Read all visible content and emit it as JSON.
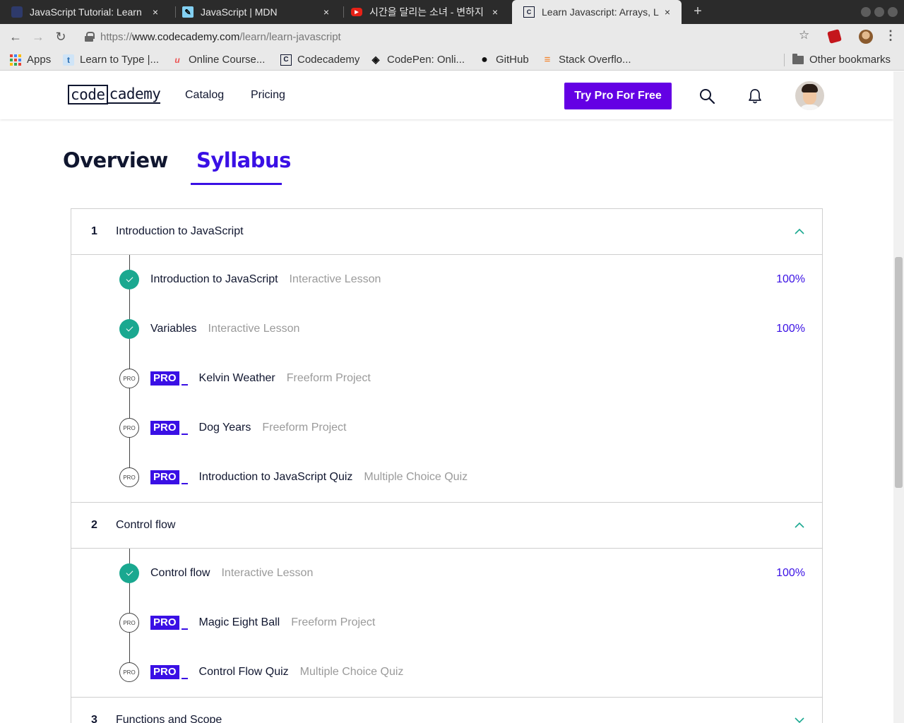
{
  "browser": {
    "tabs": [
      {
        "title": "JavaScript Tutorial: Learn",
        "favicon": "javascript-tutorial-favicon",
        "active": false
      },
      {
        "title": "JavaScript | MDN",
        "favicon": "mdn-favicon",
        "active": false
      },
      {
        "title": "시간을 달리는 소녀 - 변하지",
        "favicon": "youtube-favicon",
        "active": false
      },
      {
        "title": "Learn Javascript: Arrays, L",
        "favicon": "codecademy-favicon",
        "active": true
      }
    ],
    "close_glyph": "×",
    "new_tab_glyph": "+",
    "url": {
      "scheme": "https://",
      "host": "www.codecademy.com",
      "path": "/learn/learn-javascript"
    },
    "bookmarks": [
      {
        "label": "Apps",
        "icon": "apps-grid-icon"
      },
      {
        "label": "Learn to Type |...",
        "icon": "typing-club-icon",
        "glyph": "t"
      },
      {
        "label": "Online Course...",
        "icon": "udemy-icon",
        "glyph": "u"
      },
      {
        "label": "Codecademy",
        "icon": "codecademy-icon",
        "glyph": "C"
      },
      {
        "label": "CodePen: Onli...",
        "icon": "codepen-icon",
        "glyph": "◈"
      },
      {
        "label": "GitHub",
        "icon": "github-icon",
        "glyph": "●"
      },
      {
        "label": "Stack Overflo...",
        "icon": "stackoverflow-icon",
        "glyph": "≡"
      }
    ],
    "other_bookmarks": "Other bookmarks"
  },
  "site": {
    "logo_box": "code",
    "logo_rest": "cademy",
    "nav": [
      "Catalog",
      "Pricing"
    ],
    "cta": "Try Pro For Free"
  },
  "page_tabs": [
    {
      "label": "Overview",
      "active": false
    },
    {
      "label": "Syllabus",
      "active": true
    }
  ],
  "pro_label": "PRO",
  "modules": [
    {
      "number": "1",
      "title": "Introduction to JavaScript",
      "expanded": true,
      "lessons": [
        {
          "name": "Introduction to JavaScript",
          "type": "Interactive Lesson",
          "status": "done",
          "progress": "100%"
        },
        {
          "name": "Variables",
          "type": "Interactive Lesson",
          "status": "done",
          "progress": "100%"
        },
        {
          "name": "Kelvin Weather",
          "type": "Freeform Project",
          "status": "pro"
        },
        {
          "name": "Dog Years",
          "type": "Freeform Project",
          "status": "pro"
        },
        {
          "name": "Introduction to JavaScript Quiz",
          "type": "Multiple Choice Quiz",
          "status": "pro"
        }
      ]
    },
    {
      "number": "2",
      "title": "Control flow",
      "expanded": true,
      "lessons": [
        {
          "name": "Control flow",
          "type": "Interactive Lesson",
          "status": "done",
          "progress": "100%"
        },
        {
          "name": "Magic Eight Ball",
          "type": "Freeform Project",
          "status": "pro"
        },
        {
          "name": "Control Flow Quiz",
          "type": "Multiple Choice Quiz",
          "status": "pro"
        }
      ]
    },
    {
      "number": "3",
      "title": "Functions and Scope",
      "expanded": false,
      "lessons": []
    }
  ],
  "colors": {
    "accent": "#3a10e5",
    "cta": "#6400e4",
    "done": "#1aa890",
    "muted": "#9a9a9a",
    "ink": "#10162f"
  }
}
